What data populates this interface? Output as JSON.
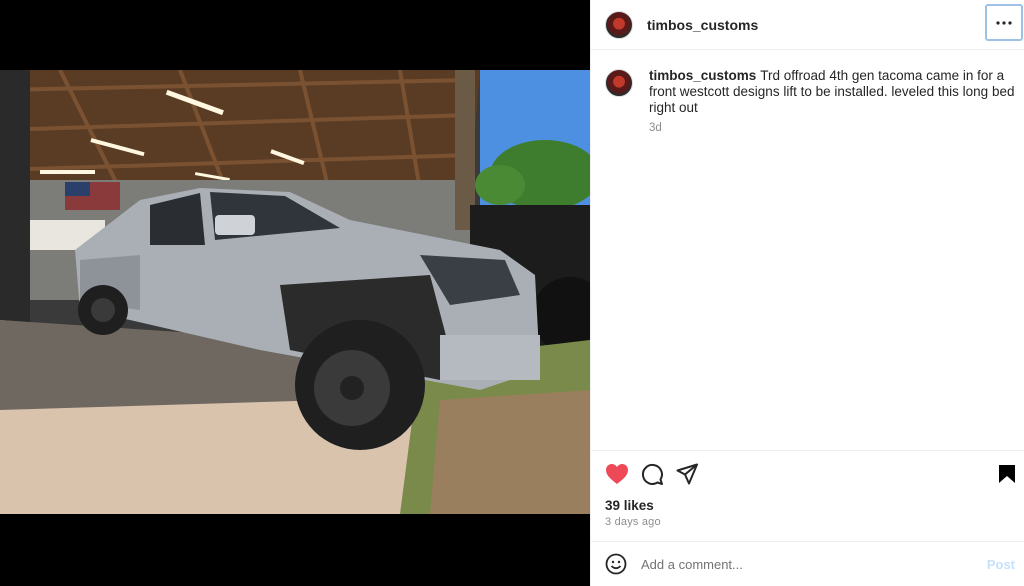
{
  "post": {
    "username": "timbos_customs",
    "caption": "Trd offroad 4th gen tacoma came in for a front westcott designs lift to be installed. leveled this long bed right out",
    "caption_time": "3d",
    "likes": "39 likes",
    "date": "3 days ago",
    "liked": true
  },
  "icons": {
    "more": "more-options-icon",
    "heart": "heart-icon",
    "comment": "comment-icon",
    "share": "share-icon",
    "bookmark": "bookmark-icon",
    "emoji": "emoji-icon"
  },
  "comment_box": {
    "placeholder": "Add a comment...",
    "post_label": "Post"
  },
  "colors": {
    "heart": "#ed4956",
    "post_button_disabled": "#c7e1fb",
    "secondary_text": "#8e8e8e"
  }
}
